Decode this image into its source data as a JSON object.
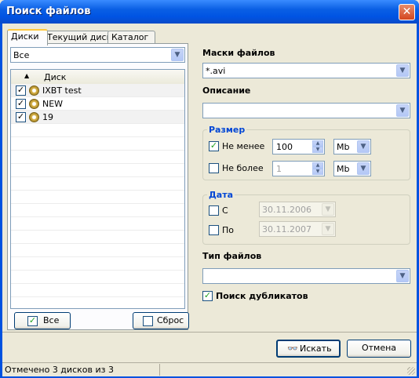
{
  "window": {
    "title": "Поиск файлов",
    "close_icon": "close-icon"
  },
  "tabs": [
    {
      "label": "Диски",
      "active": true
    },
    {
      "label": "Текущий диск",
      "active": false
    },
    {
      "label": "Каталог",
      "active": false
    }
  ],
  "disk_filter": {
    "value": "Все"
  },
  "disk_list": {
    "column_header": "Диск",
    "rows": [
      {
        "name": "IXBT test",
        "checked": true
      },
      {
        "name": "NEW",
        "checked": true
      },
      {
        "name": "19",
        "checked": true
      }
    ]
  },
  "left_buttons": {
    "select_all": "Все",
    "reset": "Сброс"
  },
  "masks": {
    "label": "Маски файлов",
    "value": "*.avi"
  },
  "description": {
    "label": "Описание",
    "value": ""
  },
  "size_group": {
    "legend": "Размер",
    "min": {
      "label": "Не менее",
      "checked": true,
      "value": "100",
      "unit": "Mb"
    },
    "max": {
      "label": "Не более",
      "checked": false,
      "value": "1",
      "unit": "Mb"
    }
  },
  "date_group": {
    "legend": "Дата",
    "from": {
      "label": "С",
      "checked": false,
      "value": "30.11.2006"
    },
    "to": {
      "label": "По",
      "checked": false,
      "value": "30.11.2007"
    }
  },
  "file_type": {
    "label": "Тип файлов",
    "value": ""
  },
  "duplicates": {
    "label": "Поиск дубликатов",
    "checked": true
  },
  "actions": {
    "search": "Искать",
    "cancel": "Отмена",
    "search_icon": "binoculars-icon"
  },
  "status": {
    "text": "Отмечено 3 дисков из 3"
  }
}
